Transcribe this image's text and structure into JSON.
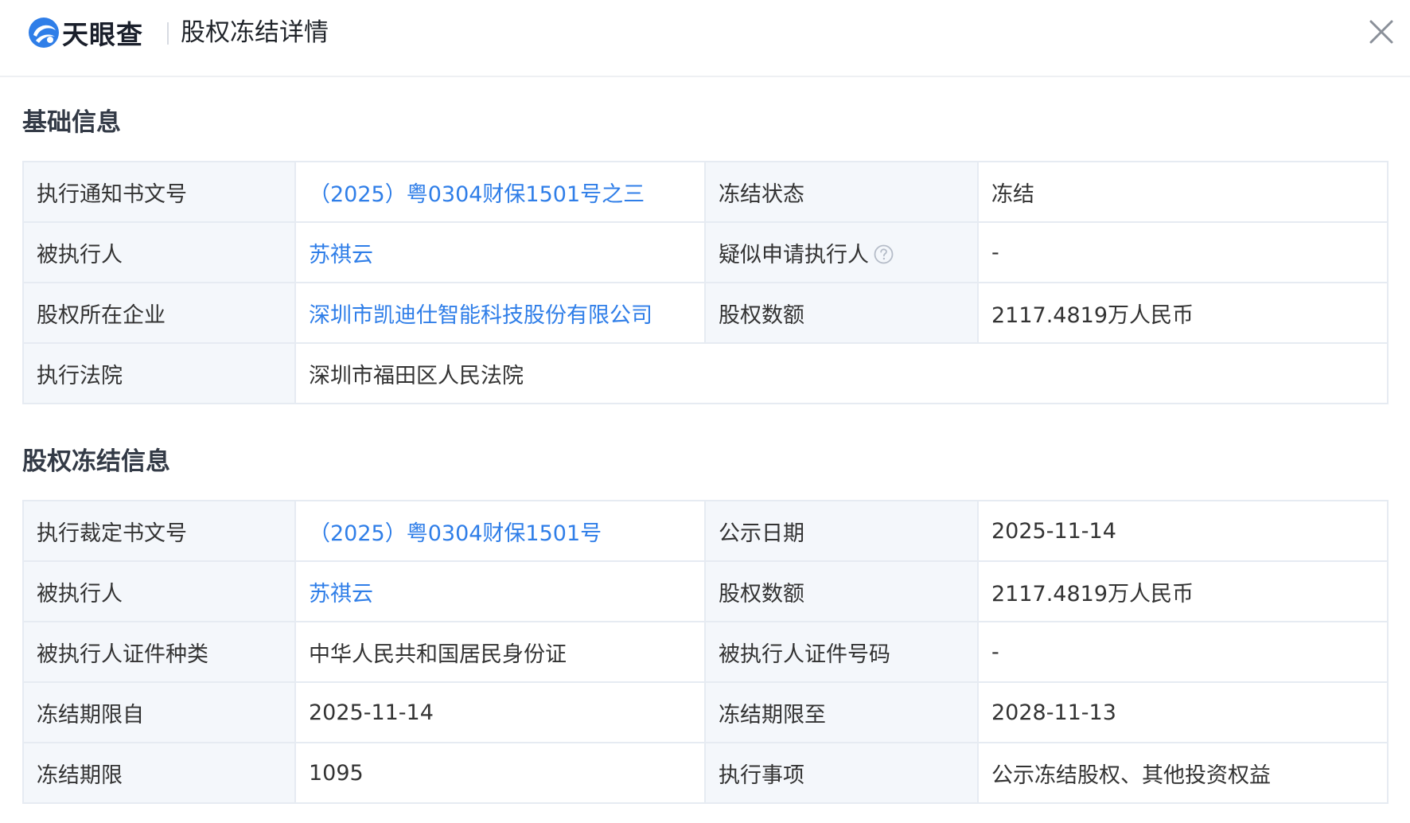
{
  "header": {
    "logo_text": "天眼查",
    "title": "股权冻结详情",
    "brand_color": "#2f7ee8"
  },
  "basic": {
    "section_title": "基础信息",
    "rows": [
      [
        {
          "label": "执行通知书文号"
        },
        {
          "value": "（2025）粤0304财保1501号之三"
        },
        {
          "label": "冻结状态"
        },
        {
          "value": "冻结"
        }
      ],
      [
        {
          "label": "被执行人"
        },
        {
          "value": "苏祺云"
        },
        {
          "label": "疑似申请执行人"
        },
        {
          "value": "-"
        }
      ],
      [
        {
          "label": "股权所在企业"
        },
        {
          "value": "深圳市凯迪仕智能科技股份有限公司"
        },
        {
          "label": "股权数额"
        },
        {
          "value": "2117.4819万人民币"
        }
      ],
      [
        {
          "label": "执行法院"
        },
        {
          "value": "深圳市福田区人民法院"
        }
      ]
    ]
  },
  "freeze": {
    "section_title": "股权冻结信息",
    "rows": [
      [
        {
          "label": "执行裁定书文号"
        },
        {
          "value": "（2025）粤0304财保1501号"
        },
        {
          "label": "公示日期"
        },
        {
          "value": "2025-11-14"
        }
      ],
      [
        {
          "label": "被执行人"
        },
        {
          "value": "苏祺云"
        },
        {
          "label": "股权数额"
        },
        {
          "value": "2117.4819万人民币"
        }
      ],
      [
        {
          "label": "被执行人证件种类"
        },
        {
          "value": "中华人民共和国居民身份证"
        },
        {
          "label": "被执行人证件号码"
        },
        {
          "value": "-"
        }
      ],
      [
        {
          "label": "冻结期限自"
        },
        {
          "value": "2025-11-14"
        },
        {
          "label": "冻结期限至"
        },
        {
          "value": "2028-11-13"
        }
      ],
      [
        {
          "label": "冻结期限"
        },
        {
          "value": "1095"
        },
        {
          "label": "执行事项"
        },
        {
          "value": "公示冻结股权、其他投资权益"
        }
      ]
    ]
  }
}
